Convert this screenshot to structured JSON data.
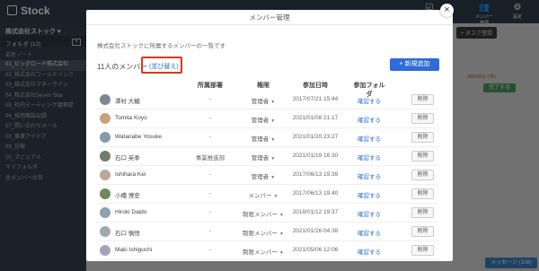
{
  "app": {
    "logo": "Stock",
    "company": "株式会社ストック",
    "folder_label": "フォルダ",
    "folder_count": "(12)",
    "folder_add": "+",
    "note_label": "最新ノート",
    "top_icons": [
      {
        "icon": "checkbox-icon",
        "caption": ""
      },
      {
        "icon": "member-icon",
        "caption": "メンバー管理"
      },
      {
        "icon": "settings-icon",
        "caption": "設定"
      }
    ],
    "folders": [
      "01_ビッグロード株式会社",
      "02_株式会社ワールドリンク",
      "03_株式会社マネーライン",
      "04_株式会社Seven Star",
      "05_社内ミーティング議事録",
      "06_採用面談記録",
      "07_問い合わせメール",
      "08_事業アイデア",
      "09_日報",
      "10_マニュアル",
      "マイフォルダ",
      "全メンバー共有"
    ],
    "bg_task_button": "+ タスク登録",
    "bg_date": "29/03/11 (木)",
    "bg_done": "完了する",
    "bg_message": "メッセージ (108)"
  },
  "modal": {
    "title": "メンバー管理",
    "description": "株式会社ストックに所属するメンバーの一覧です",
    "count_label": "11人のメンバー",
    "sort_link": "(並び替え)",
    "add_button": "+ 新規追加",
    "close": "×",
    "columns": {
      "dept": "所属部署",
      "role": "権限",
      "joined": "参加日時",
      "folder": "参加フォルダ"
    },
    "members": [
      {
        "name": "澤村 大輔",
        "dept": "-",
        "role": "管理者",
        "joined": "2017/07/21 15:44",
        "folder": "確認する",
        "delete": "削除"
      },
      {
        "name": "Tomita Koyo",
        "dept": "-",
        "role": "管理者",
        "joined": "2021/01/08 21:17",
        "folder": "確認する",
        "delete": "削除"
      },
      {
        "name": "Watanabe Yosuke",
        "dept": "-",
        "role": "管理者",
        "joined": "2021/01/20 23:27",
        "folder": "確認する",
        "delete": "削除"
      },
      {
        "name": "石口 英季",
        "dept": "事業推進部",
        "role": "管理者",
        "joined": "2021/01/19 16:30",
        "folder": "確認する",
        "delete": "削除"
      },
      {
        "name": "Ishihara Kei",
        "dept": "-",
        "role": "管理者",
        "joined": "2017/06/13 19:39",
        "folder": "確認する",
        "delete": "削除"
      },
      {
        "name": "小橋 博史",
        "dept": "-",
        "role": "メンバー",
        "joined": "2017/06/13 19:40",
        "folder": "確認する",
        "delete": "削除"
      },
      {
        "name": "Hiroki Daido",
        "dept": "-",
        "role": "制限メンバー",
        "joined": "2018/01/12 19:37",
        "folder": "確認する",
        "delete": "削除"
      },
      {
        "name": "石口 慎悟",
        "dept": "-",
        "role": "制限メンバー",
        "joined": "2021/01/26 04:38",
        "folder": "確認する",
        "delete": "削除"
      },
      {
        "name": "Maki Ishiguchi",
        "dept": "-",
        "role": "制限メンバー",
        "joined": "2021/05/06 12:06",
        "folder": "確認する",
        "delete": "削除"
      }
    ]
  }
}
